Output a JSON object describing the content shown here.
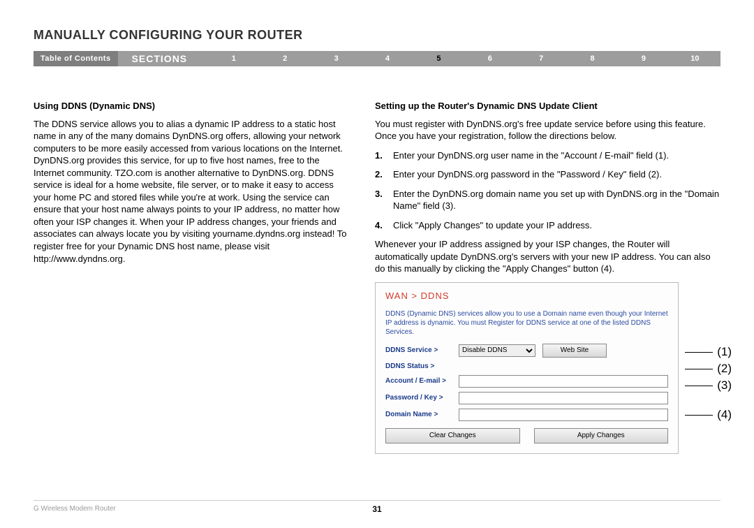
{
  "title": "MANUALLY CONFIGURING YOUR ROUTER",
  "nav": {
    "toc": "Table of Contents",
    "sections": "SECTIONS",
    "items": [
      "1",
      "2",
      "3",
      "4",
      "5",
      "6",
      "7",
      "8",
      "9",
      "10"
    ],
    "active_index": 4
  },
  "left": {
    "heading": "Using DDNS (Dynamic DNS)",
    "body": "The DDNS service allows you to alias a dynamic IP address to a static host name in any of the many domains DynDNS.org offers, allowing your network computers to be more easily accessed from various locations on the Internet. DynDNS.org provides this service, for up to five host names, free to the Internet community. TZO.com is another alternative to DynDNS.org. DDNS service is ideal for a home website, file server, or to make it easy to access your home PC and stored files while you're at work. Using the service can ensure that your host name always points to your IP address, no matter how often your ISP changes it. When your IP address changes, your friends and associates can always locate you by visiting yourname.dyndns.org instead! To register free for your Dynamic DNS host name, please visit http://www.dyndns.org."
  },
  "right": {
    "heading": "Setting up the Router's Dynamic DNS Update Client",
    "intro": "You must register with DynDNS.org's free update service before using this feature. Once you have your registration, follow the directions below.",
    "steps": [
      "Enter your DynDNS.org user name in the \"Account / E-mail\" field (1).",
      "Enter your DynDNS.org password in the \"Password / Key\" field (2).",
      "Enter the DynDNS.org domain name you set up with DynDNS.org in the \"Domain Name\" field (3).",
      "Click \"Apply Changes\" to update your IP address."
    ],
    "outro": "Whenever your IP address assigned by your ISP changes, the Router will automatically update DynDNS.org's servers with your new IP address. You can also do this manually by clicking the \"Apply Changes\" button (4)."
  },
  "ui": {
    "breadcrumb": "WAN > DDNS",
    "desc": "DDNS (Dynamic DNS) services allow you to use a Domain name even though your Internet IP address is dynamic. You must Register for DDNS service at one of the listed DDNS Services.",
    "labels": {
      "service": "DDNS Service >",
      "status": "DDNS Status >",
      "account": "Account / E-mail >",
      "password": "Password / Key >",
      "domain": "Domain Name >"
    },
    "service_value": "Disable DDNS",
    "website_btn": "Web Site",
    "clear_btn": "Clear Changes",
    "apply_btn": "Apply Changes"
  },
  "callouts": [
    "(1)",
    "(2)",
    "(3)",
    "(4)"
  ],
  "footer": {
    "product": "G Wireless Modem Router",
    "page": "31"
  }
}
